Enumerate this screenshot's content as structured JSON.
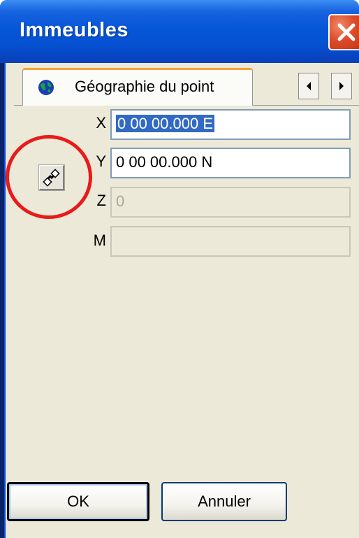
{
  "window": {
    "title": "Immeubles"
  },
  "tab": {
    "label": "Géographie du point",
    "icon": "globe-icon"
  },
  "fields": {
    "x": {
      "label": "X",
      "value": "0 00 00.000 E",
      "selected": true,
      "enabled": true
    },
    "y": {
      "label": "Y",
      "value": "0 00 00.000 N",
      "selected": false,
      "enabled": true
    },
    "z": {
      "label": "Z",
      "value": "0",
      "enabled": false
    },
    "m": {
      "label": "M",
      "value": "",
      "enabled": false
    }
  },
  "tool": {
    "icon": "zoom-to-point-icon",
    "highlighted": true
  },
  "buttons": {
    "ok": "OK",
    "cancel": "Annuler"
  },
  "colors": {
    "titlebar": "#0756d8",
    "close": "#de4b2a",
    "selection": "#316ac5",
    "highlight_circle": "#e81a1a",
    "dialog_background": "#ece9d8"
  }
}
